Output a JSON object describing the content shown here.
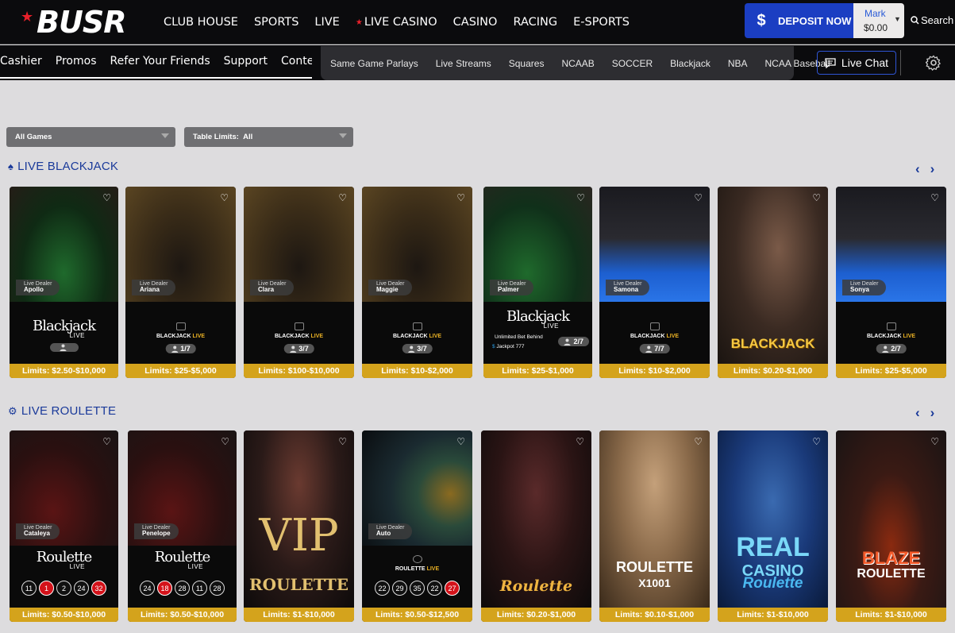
{
  "brand": {
    "logo_text": "BUSR"
  },
  "main_nav": [
    {
      "label": "CLUB HOUSE"
    },
    {
      "label": "SPORTS"
    },
    {
      "label": "LIVE"
    },
    {
      "label": "LIVE CASINO"
    },
    {
      "label": "CASINO"
    },
    {
      "label": "RACING"
    },
    {
      "label": "E-SPORTS"
    }
  ],
  "deposit": {
    "label": "DEPOSIT NOW",
    "icon": "dollar-icon"
  },
  "account": {
    "name": "Mark",
    "balance": "$0.00"
  },
  "search": {
    "label": "Search"
  },
  "sub_nav": [
    {
      "label": "Cashier"
    },
    {
      "label": "Promos"
    },
    {
      "label": "Refer Your Friends"
    },
    {
      "label": "Support"
    },
    {
      "label": "Contests"
    }
  ],
  "quick_links": [
    {
      "label": "Same Game Parlays"
    },
    {
      "label": "Live Streams"
    },
    {
      "label": "Squares"
    },
    {
      "label": "NCAAB"
    },
    {
      "label": "SOCCER"
    },
    {
      "label": "Blackjack"
    },
    {
      "label": "NBA"
    },
    {
      "label": "NCAA Baseball"
    }
  ],
  "live_chat": {
    "label": "Live Chat"
  },
  "filters": {
    "games": "All Games",
    "table_limits_label": "Table Limits:",
    "table_limits_value": "All"
  },
  "colors": {
    "accent_blue": "#1b3ec2",
    "limits_gold": "#d4a31c",
    "section_title": "#1a3a9a",
    "brand_red": "#e8202a"
  },
  "blackjack": {
    "title": "LIVE BLACKJACK",
    "cards": [
      {
        "dealer_tag": "Live Dealer",
        "dealer": "Apollo",
        "logo": "Blackjack",
        "logo_sub": "LIVE",
        "seats": "",
        "limits": "Limits: $2.50-$10,000"
      },
      {
        "dealer_tag": "Live Dealer",
        "dealer": "Ariana",
        "logo": "BLACKJACK",
        "logo_sub": "LIVE",
        "seats": "1/7",
        "limits": "Limits: $25-$5,000"
      },
      {
        "dealer_tag": "Live Dealer",
        "dealer": "Clara",
        "logo": "BLACKJACK",
        "logo_sub": "LIVE",
        "seats": "3/7",
        "limits": "Limits: $100-$10,000"
      },
      {
        "dealer_tag": "Live Dealer",
        "dealer": "Maggie",
        "logo": "BLACKJACK",
        "logo_sub": "LIVE",
        "seats": "3/7",
        "limits": "Limits: $10-$2,000"
      },
      {
        "dealer_tag": "Live Dealer",
        "dealer": "Palmer",
        "logo": "Blackjack",
        "logo_sub": "LIVE",
        "line1": "Unlimited Bet Behind",
        "line2": "Jackpot 777",
        "seats": "2/7",
        "limits": "Limits: $25-$1,000"
      },
      {
        "dealer_tag": "Live Dealer",
        "dealer": "Samona",
        "logo": "BLACKJACK",
        "logo_sub": "LIVE",
        "seats": "7/7",
        "limits": "Limits: $10-$2,000"
      },
      {
        "dealer_tag": "",
        "dealer": "",
        "big": "BLACKJACK",
        "seats": "",
        "limits": "Limits: $0.20-$1,000"
      },
      {
        "dealer_tag": "Live Dealer",
        "dealer": "Sonya",
        "logo": "BLACKJACK",
        "logo_sub": "LIVE",
        "seats": "2/7",
        "limits": "Limits: $25-$5,000"
      }
    ]
  },
  "roulette": {
    "title": "LIVE ROULETTE",
    "cards": [
      {
        "dealer_tag": "Live Dealer",
        "dealer": "Cataleya",
        "logo": "Roulette",
        "logo_sub": "LIVE",
        "numbers": [
          "11",
          "1",
          "2",
          "24",
          "32"
        ],
        "red": [
          "1",
          "32"
        ],
        "limits": "Limits: $0.50-$10,000"
      },
      {
        "dealer_tag": "Live Dealer",
        "dealer": "Penelope",
        "logo": "Roulette",
        "logo_sub": "LIVE",
        "numbers": [
          "24",
          "18",
          "28",
          "11",
          "28"
        ],
        "red": [
          "18"
        ],
        "limits": "Limits: $0.50-$10,000"
      },
      {
        "big1": "VIP",
        "big2": "ROULETTE",
        "limits": "Limits: $1-$10,000"
      },
      {
        "dealer_tag": "Live Dealer",
        "dealer": "Auto",
        "logo": "ROULETTE",
        "logo_sub": "LIVE",
        "numbers": [
          "22",
          "29",
          "35",
          "22",
          "27"
        ],
        "red": [
          "27"
        ],
        "limits": "Limits: $0.50-$12,500"
      },
      {
        "big1": "Roulette",
        "limits": "Limits: $0.20-$1,000"
      },
      {
        "big1": "ROULETTE",
        "big2": "X1001",
        "limits": "Limits: $0.10-$1,000"
      },
      {
        "big1": "REAL",
        "big2": "CASINO",
        "big3": "Roulette",
        "limits": "Limits: $1-$10,000"
      },
      {
        "big1": "BLAZE",
        "big2": "ROULETTE",
        "limits": "Limits: $1-$10,000"
      }
    ]
  }
}
